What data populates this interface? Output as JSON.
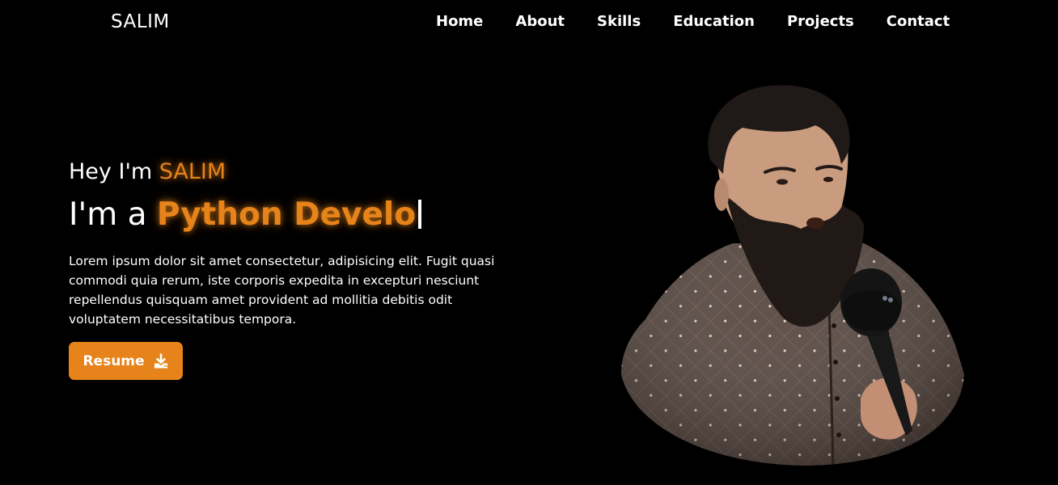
{
  "brand": {
    "logo_text": "SALIM",
    "accent_color": "#e6831a"
  },
  "nav": {
    "items": [
      {
        "label": "Home"
      },
      {
        "label": "About"
      },
      {
        "label": "Skills"
      },
      {
        "label": "Education"
      },
      {
        "label": "Projects"
      },
      {
        "label": "Contact"
      }
    ]
  },
  "hero": {
    "greeting_prefix": "Hey I'm ",
    "greeting_name": "SALIM",
    "role_prefix": "I'm a ",
    "role_typed": "Python Develo",
    "description": "Lorem ipsum dolor sit amet consectetur, adipisicing elit. Fugit quasi commodi quia rerum, iste corporis expedita in excepturi nesciunt repellendus quisquam amet provident ad mollitia debitis odit voluptatem necessitatibus tempora.",
    "resume_label": "Resume",
    "resume_icon": "download-icon"
  },
  "portrait": {
    "icon": "profile-photo"
  }
}
